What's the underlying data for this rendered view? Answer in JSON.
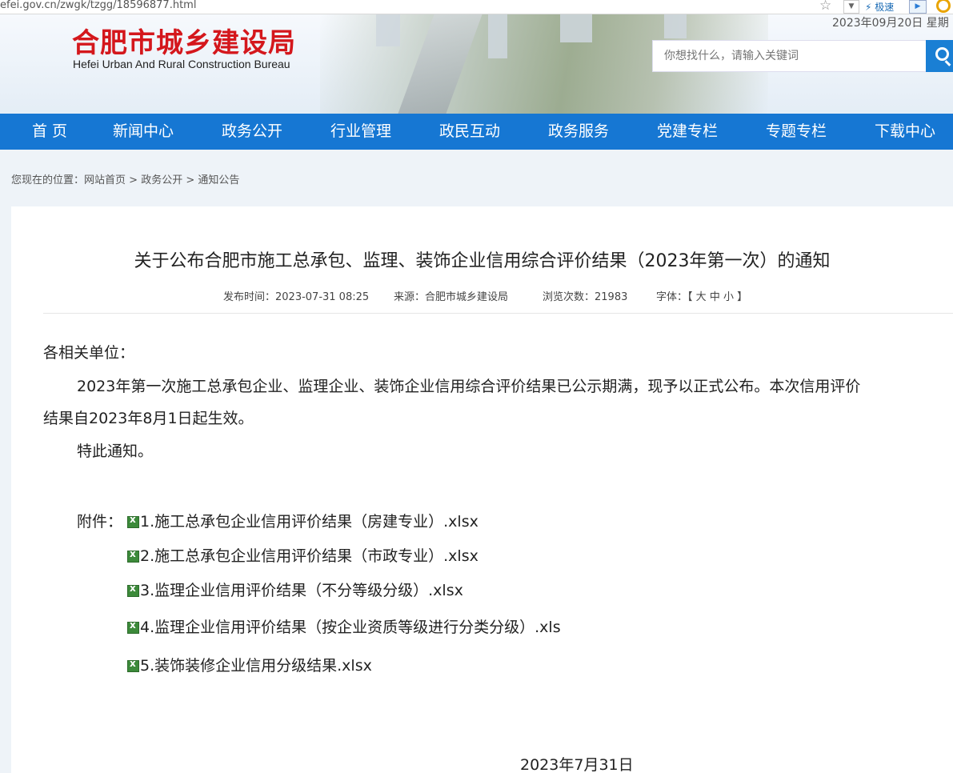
{
  "browser": {
    "url": "efei.gov.cn/zwgk/tzgg/18596877.html",
    "speed_label": "极速"
  },
  "header": {
    "logo_cn": "合肥市城乡建设局",
    "logo_en": "Hefei Urban And Rural Construction Bureau",
    "date": "2023年09月20日 星期",
    "search_placeholder": "你想找什么，请输入关键词"
  },
  "nav": {
    "items": [
      {
        "label": "首 页",
        "id": "home"
      },
      {
        "label": "新闻中心",
        "id": "news"
      },
      {
        "label": "政务公开",
        "id": "gov-affairs"
      },
      {
        "label": "行业管理",
        "id": "industry"
      },
      {
        "label": "政民互动",
        "id": "interaction"
      },
      {
        "label": "政务服务",
        "id": "services"
      },
      {
        "label": "党建专栏",
        "id": "party"
      },
      {
        "label": "专题专栏",
        "id": "topics"
      },
      {
        "label": "下载中心",
        "id": "downloads"
      }
    ]
  },
  "breadcrumb": {
    "prefix": "您现在的位置：",
    "home": "网站首页",
    "sep1": " > ",
    "section": "政务公开",
    "sep2": " > ",
    "page": "通知公告"
  },
  "article": {
    "title": "关于公布合肥市施工总承包、监理、装饰企业信用综合评价结果（2023年第一次）的通知",
    "publish_time": "发布时间：2023-07-31 08:25",
    "source": "来源：合肥市城乡建设局",
    "views": "浏览次数：21983",
    "font_label": "字体：【",
    "font_large": "大",
    "font_medium": "中",
    "font_small": "小",
    "font_end": "】",
    "salutation": "各相关单位：",
    "body_line1": "2023年第一次施工总承包企业、监理企业、装饰企业信用综合评价结果已公示期满，现予以正式公布。本次信用评价",
    "body_line2": "结果自2023年8月1日起生效。",
    "closing": "特此通知。",
    "attachments_label": "附件：",
    "attachments": [
      "1.施工总承包企业信用评价结果（房建专业）.xlsx",
      "2.施工总承包企业信用评价结果（市政专业）.xlsx",
      "3.监理企业信用评价结果（不分等级分级）.xlsx",
      "4.监理企业信用评价结果（按企业资质等级进行分类分级）.xls",
      "5.装饰装修企业信用分级结果.xlsx"
    ],
    "sign_date": "2023年7月31日"
  },
  "icons": {
    "attachment": "excel-file-icon",
    "search": "search-icon",
    "bookmark": "star-icon"
  }
}
